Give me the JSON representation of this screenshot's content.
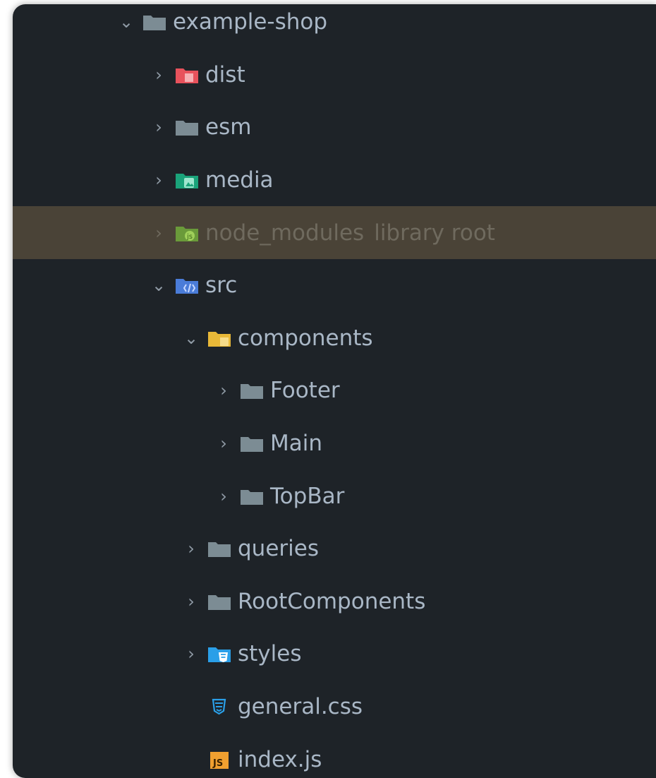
{
  "tree": {
    "root": {
      "label": "example-shop",
      "icon": "folder-icon"
    },
    "items": [
      {
        "label": "dist",
        "icon": "excluded-folder-icon"
      },
      {
        "label": "esm",
        "icon": "folder-icon"
      },
      {
        "label": "media",
        "icon": "resource-folder-icon"
      },
      {
        "label": "node_modules",
        "suffix": "library root",
        "icon": "node-modules-folder-icon"
      },
      {
        "label": "src",
        "icon": "source-folder-icon"
      },
      {
        "label": "components",
        "icon": "package-folder-icon"
      },
      {
        "label": "Footer",
        "icon": "folder-icon"
      },
      {
        "label": "Main",
        "icon": "folder-icon"
      },
      {
        "label": "TopBar",
        "icon": "folder-icon"
      },
      {
        "label": "queries",
        "icon": "folder-icon"
      },
      {
        "label": "RootComponents",
        "icon": "folder-icon"
      },
      {
        "label": "styles",
        "icon": "css-folder-icon"
      },
      {
        "label": "general.css",
        "icon": "css-file-icon"
      },
      {
        "label": "index.js",
        "icon": "js-file-icon"
      }
    ]
  },
  "colors": {
    "background": "#1e2328",
    "text": "#a9b7c6",
    "selection": "#4a4337",
    "folder": "#7c8c94",
    "excluded_folder": "#e8525c",
    "resource_folder": "#1aa37a",
    "node_modules_folder": "#6a9a3a",
    "source_folder": "#4a7cd8",
    "package_folder": "#e8b838",
    "css_blue": "#2a9fe8",
    "js_orange": "#f0a030"
  }
}
